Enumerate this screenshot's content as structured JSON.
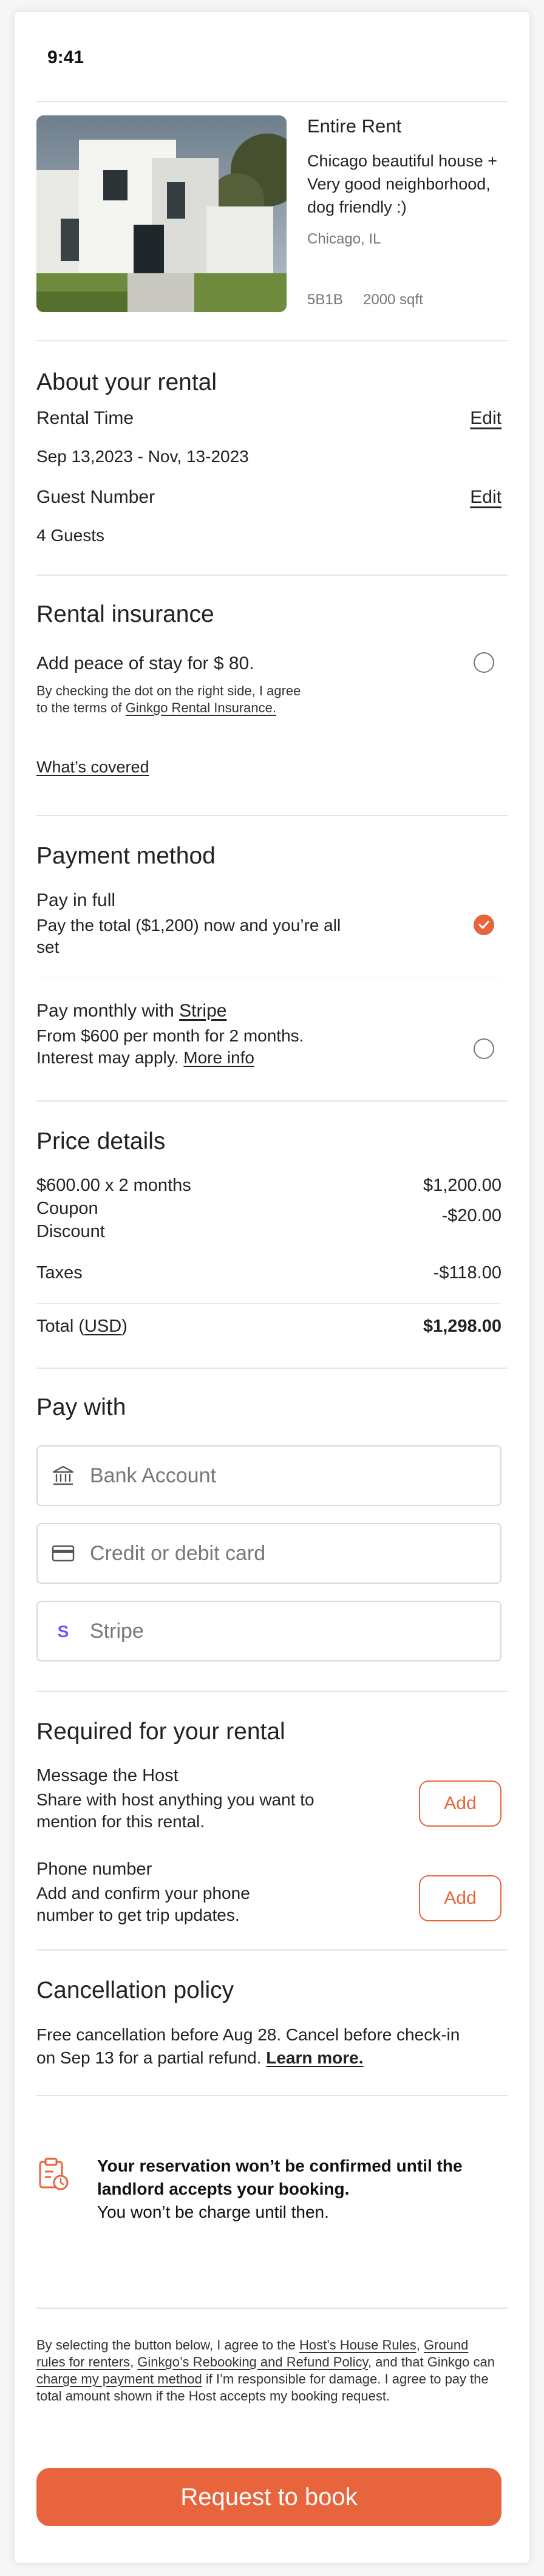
{
  "status_bar": {
    "time": "9:41"
  },
  "listing": {
    "type": "Entire Rent",
    "description": "Chicago beautiful house + Very good neighborhood, dog friendly :)",
    "location": "Chicago, IL",
    "rooms": "5B1B",
    "area": "2000 sqft"
  },
  "about": {
    "title": "About your rental",
    "rental_time_label": "Rental Time",
    "rental_time_value": "Sep 13,2023 - Nov, 13-2023",
    "guest_label": "Guest Number",
    "guest_value": "4 Guests",
    "edit_label": "Edit"
  },
  "insurance": {
    "title": "Rental insurance",
    "offer": "Add peace of stay for $ 80.",
    "terms_prefix": "By checking the dot on the right side, I agree to the terms of ",
    "terms_link": "Ginkgo Rental Insurance.",
    "covered_link": "What’s covered"
  },
  "payment": {
    "title": "Payment method",
    "full_title": "Pay in full",
    "full_desc": "Pay the total ($1,200) now and you’re all set",
    "monthly_title_prefix": "Pay monthly with ",
    "monthly_title_link": "Stripe",
    "monthly_desc": "From $600 per month for 2 months. Interest may apply. ",
    "monthly_more": "More info"
  },
  "price": {
    "title": "Price details",
    "rows": [
      {
        "label": "$600.00 x 2 months",
        "value": "$1,200.00"
      },
      {
        "label": "Coupon",
        "value": "-$20.00"
      },
      {
        "label": "Discount",
        "value": ""
      },
      {
        "label": "Taxes",
        "value": "-$118.00"
      }
    ],
    "total_label_prefix": "Total (",
    "total_currency": "USD",
    "total_label_suffix": ")",
    "total_value": "$1,298.00"
  },
  "pay_with": {
    "title": "Pay with",
    "options": [
      {
        "label": "Bank Account",
        "icon": "bank-icon"
      },
      {
        "label": "Credit or debit card",
        "icon": "credit-card-icon"
      },
      {
        "label": "Stripe",
        "icon": "stripe-icon"
      }
    ]
  },
  "required": {
    "title": "Required for your rental",
    "message_title": "Message the Host",
    "message_desc": "Share with host anything you want to mention for this rental.",
    "phone_title": "Phone number",
    "phone_desc": "Add and confirm your phone number to get trip updates.",
    "add_label": "Add"
  },
  "cancellation": {
    "title": "Cancellation policy",
    "text": "Free cancellation before Aug 28. Cancel before check-in on Sep 13 for a partial refund. ",
    "learn_more": "Learn more."
  },
  "notice": {
    "bold_text": "Your reservation won’t be confirmed until the landlord accepts your booking.",
    "sub_text": "You won’t be charge until then."
  },
  "legal": {
    "p1": "By selecting the button below, I agree to the ",
    "l1": "Host’s House Rules",
    "p2": ", ",
    "l2": "Ground rules for renters",
    "p3": ", ",
    "l3": "Ginkgo’s Rebooking and Refund Policy",
    "p4": ", and that Ginkgo can ",
    "l4": "charge my payment method",
    "p5": " if I’m responsible for damage. I agree to pay the total amount shown if the Host accepts my booking request."
  },
  "cta": {
    "label": "Request to book"
  },
  "colors": {
    "accent": "#e8643c",
    "stripe": "#635bff"
  }
}
